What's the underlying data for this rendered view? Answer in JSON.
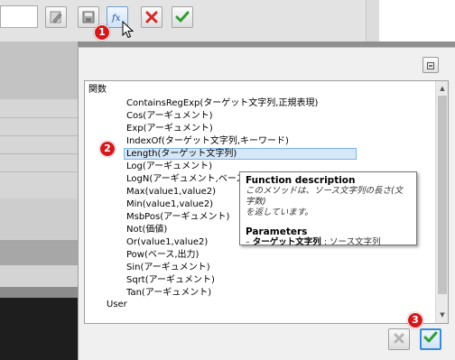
{
  "tree": {
    "root_label": "関数",
    "items": [
      "ContainsRegExp(ターゲット文字列,正規表現)",
      "Cos(アーギュメント)",
      "Exp(アーギュメント)",
      "IndexOf(ターゲット文字列,キーワード)",
      "Length(ターゲット文字列)",
      "Log(アーギュメント)",
      "LogN(アーギュメント,ベース)",
      "Max(value1,value2)",
      "Min(value1,value2)",
      "MsbPos(アーギュメント)",
      "Not(価値)",
      "Or(value1,value2)",
      "Pow(ベース,出力)",
      "Sin(アーギュメント)",
      "Sqrt(アーギュメント)",
      "Tan(アーギュメント)"
    ],
    "selected_index": 4,
    "second_root_label": "User"
  },
  "tooltip": {
    "title": "Function description",
    "description_line1": "このメソッドは、ソース文字列の長さ(文字数)",
    "description_line2": "を返しています。",
    "params_title": "Parameters",
    "param_prefix": "– ",
    "param_name": "ターゲット文字列",
    "param_sep": " : ",
    "param_desc": "ソース文字列"
  },
  "callouts": {
    "one": "1",
    "two": "2",
    "three": "3"
  },
  "icons": {
    "toolbar": [
      "edit-pencil-icon",
      "save-disk-icon",
      "function-fx-icon",
      "delete-x-icon",
      "confirm-check-icon"
    ],
    "dialog": [
      "collapse-minus-icon",
      "cancel-x-icon",
      "ok-check-icon"
    ]
  },
  "toolbar": {
    "fx_label": "fx"
  },
  "colors": {
    "accent_blue": "#3b8ad9",
    "callout_red": "#d3191b",
    "check_green": "#2f9e33",
    "delete_red": "#d02a2a",
    "selection": "#d6e7f8"
  }
}
